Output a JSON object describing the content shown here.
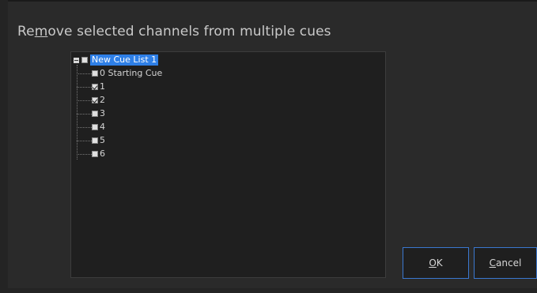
{
  "dialog": {
    "title_before": "Re",
    "title_mnemonic": "m",
    "title_after": "ove selected channels from multiple cues"
  },
  "tree": {
    "root": {
      "label": "New Cue List 1",
      "checked": false,
      "expanded": true,
      "selected": true
    },
    "items": [
      {
        "label": "0 Starting Cue",
        "checked": false
      },
      {
        "label": "1",
        "checked": true
      },
      {
        "label": "2",
        "checked": true
      },
      {
        "label": "3",
        "checked": false
      },
      {
        "label": "4",
        "checked": false
      },
      {
        "label": "5",
        "checked": false
      },
      {
        "label": "6",
        "checked": false
      }
    ]
  },
  "buttons": {
    "ok_mnemonic": "O",
    "ok_rest": "K",
    "cancel_mnemonic": "C",
    "cancel_rest": "ancel"
  }
}
